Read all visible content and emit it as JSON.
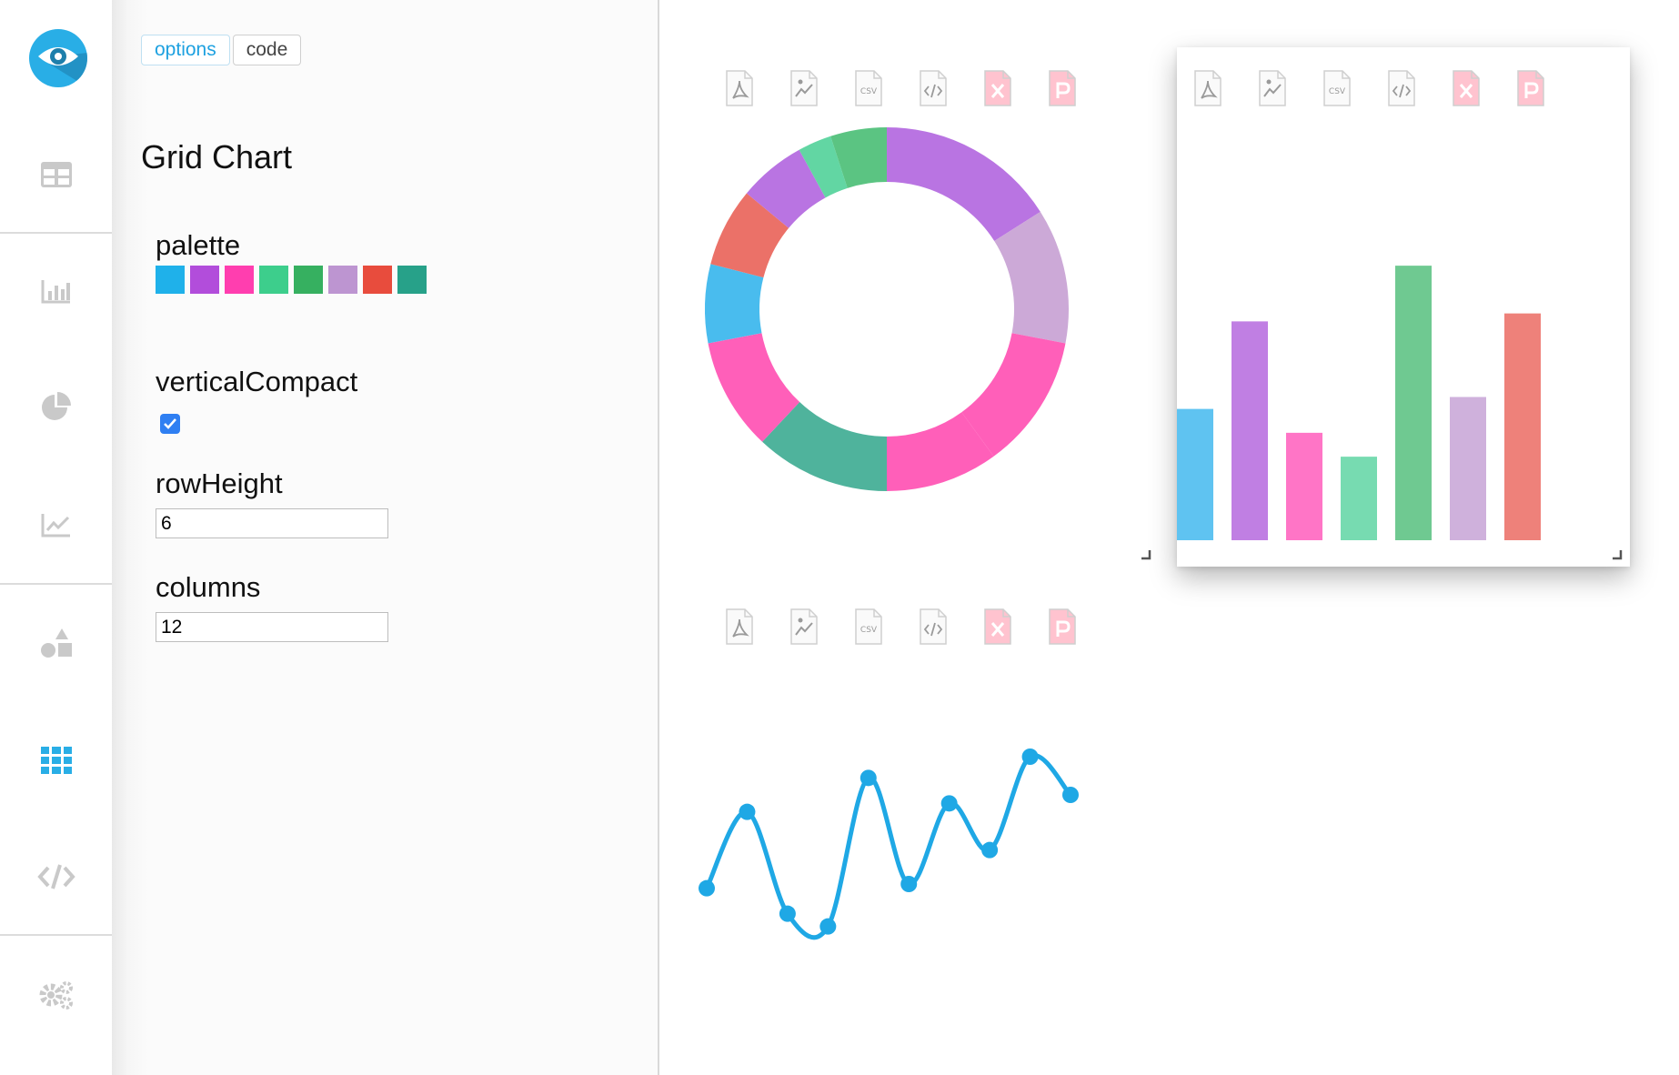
{
  "tabs": [
    {
      "label": "options",
      "active": true
    },
    {
      "label": "code",
      "active": false
    }
  ],
  "panel": {
    "title": "Grid Chart",
    "palette_label": "palette",
    "palette": [
      "#1fb1ea",
      "#b24ddb",
      "#ff3eaf",
      "#3dce8c",
      "#36b060",
      "#bd95d1",
      "#e84c3d",
      "#27a189"
    ],
    "vertical_compact_label": "verticalCompact",
    "vertical_compact_checked": true,
    "row_height_label": "rowHeight",
    "row_height_value": "6",
    "columns_label": "columns",
    "columns_value": "12"
  },
  "sidebar": {
    "items": [
      {
        "name": "table-icon",
        "active": false
      },
      {
        "name": "bar-chart-icon",
        "active": false
      },
      {
        "name": "pie-chart-icon",
        "active": false
      },
      {
        "name": "line-chart-icon",
        "active": false
      },
      {
        "name": "shapes-icon",
        "active": false
      },
      {
        "name": "grid-icon",
        "active": true
      },
      {
        "name": "code-icon",
        "active": false
      },
      {
        "name": "settings-icon",
        "active": false
      }
    ],
    "accent": "#29aee6"
  },
  "export_icons": [
    "pdf-icon",
    "image-icon",
    "csv-icon",
    "html-icon",
    "excel-icon",
    "powerpoint-icon"
  ],
  "export_labels": {
    "csv": "CSV"
  },
  "chart_data": [
    {
      "type": "pie",
      "donut": true,
      "values": [
        16,
        12,
        12,
        10,
        12,
        10,
        7,
        7,
        6,
        3
      ],
      "colors": [
        "#b974e2",
        "#cca9d7",
        "#ff5fb9",
        "#ff5fb9",
        "#4fb39c",
        "#ff5fb9",
        "#49bcee",
        "#eb7168",
        "#b974e2",
        "#62d6a3"
      ],
      "extra_slice": {
        "value": 5,
        "color": "#5bc482"
      }
    },
    {
      "type": "bar",
      "values": [
        33,
        55,
        27,
        21,
        69,
        36,
        57
      ],
      "colors": [
        "#5fc3f1",
        "#c07fe3",
        "#ff75c6",
        "#77dbb1",
        "#6fc991",
        "#cfb1dc",
        "#ee817a"
      ],
      "ylim": [
        0,
        80
      ]
    },
    {
      "type": "line",
      "x": [
        0,
        1,
        2,
        3,
        4,
        5,
        6,
        7,
        8,
        9
      ],
      "values": [
        20,
        38,
        14,
        11,
        46,
        21,
        40,
        29,
        51,
        42
      ],
      "ylim": [
        0,
        60
      ],
      "color": "#1fa8e5"
    }
  ]
}
